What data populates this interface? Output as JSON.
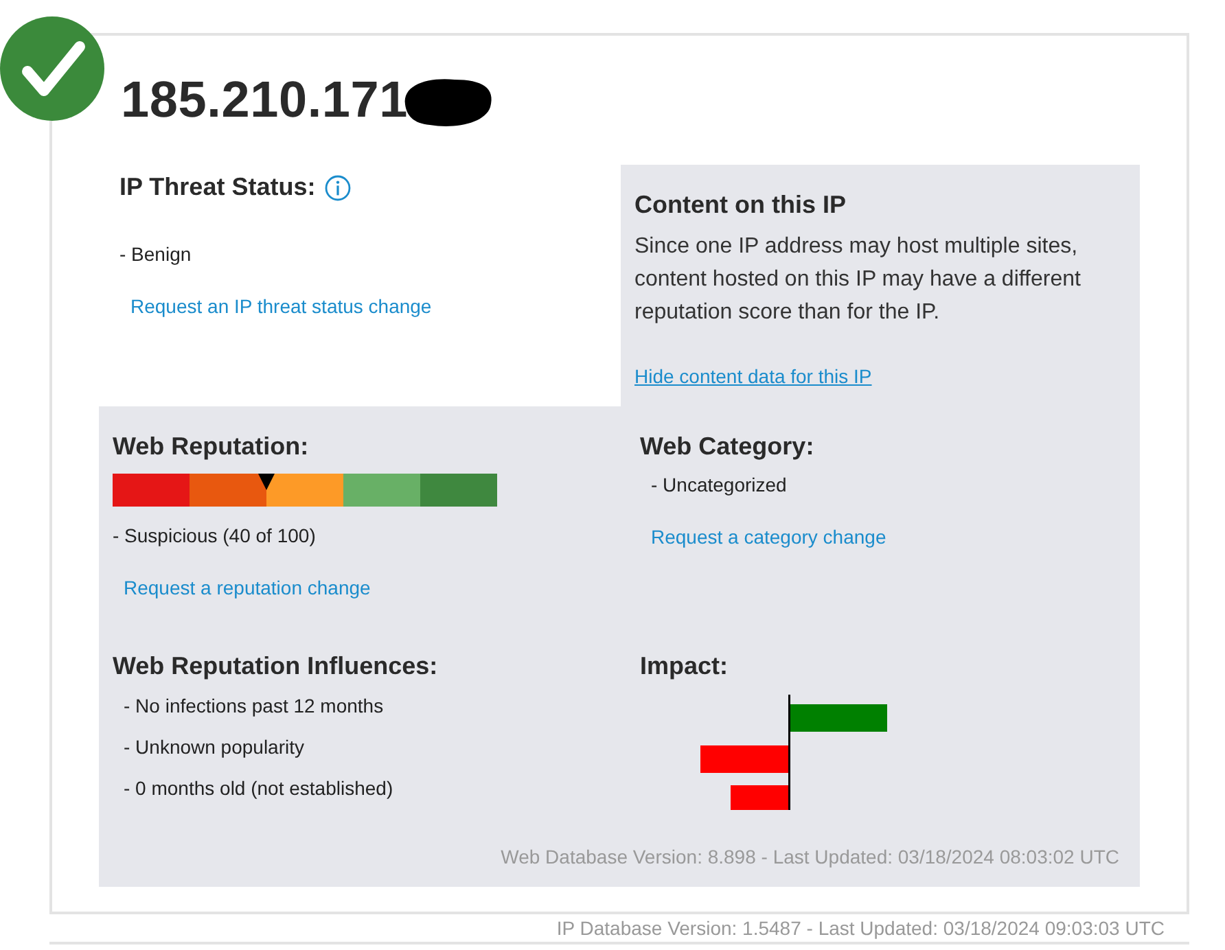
{
  "title": "185.210.171",
  "threat_status": {
    "heading": "IP Threat Status:",
    "value": "- Benign",
    "link": "Request an IP threat status change"
  },
  "content_panel": {
    "heading": "Content on this IP",
    "text": "Since one IP address may host multiple sites, content hosted on this IP may have a different reputation score than for the IP.",
    "link": "Hide content data for this IP"
  },
  "web_reputation": {
    "heading": "Web Reputation:",
    "meter": {
      "level": 0.4
    },
    "value": "- Suspicious (40 of 100)",
    "link": "Request a reputation change"
  },
  "web_category": {
    "heading": "Web Category:",
    "value": "- Uncategorized",
    "link": "Request a category change"
  },
  "influences": {
    "heading": "Web Reputation Influences:",
    "items": [
      "- No infections past 12 months",
      "- Unknown popularity",
      "- 0 months old (not established)"
    ]
  },
  "impact": {
    "heading": "Impact:"
  },
  "web_db_version": "Web Database Version: 8.898 - Last Updated: 03/18/2024 08:03:02 UTC",
  "ip_db_version": "IP Database Version: 1.5487 - Last Updated: 03/18/2024 09:03:03 UTC"
}
